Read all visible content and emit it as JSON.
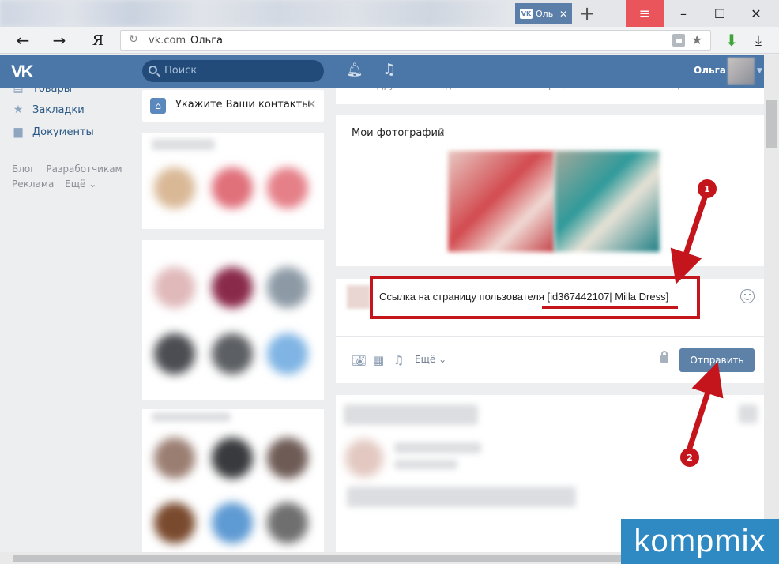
{
  "browser": {
    "tab_title": "Оль",
    "tab_favicon": "VK",
    "new_tab": "+",
    "menu_icon": "≡",
    "min_icon": "–",
    "max_icon": "☐",
    "close_icon": "✕",
    "back_icon": "←",
    "forward_icon": "→",
    "yandex_icon": "Я",
    "url_domain": "vk.com",
    "url_title": "Ольга"
  },
  "vk_header": {
    "logo": "VK",
    "search_placeholder": "Поиск",
    "user_name": "Ольга"
  },
  "left_nav": {
    "items": [
      {
        "label": "Товары"
      },
      {
        "label": "Закладки"
      },
      {
        "label": "Документы"
      }
    ],
    "footer_links": [
      "Блог",
      "Разработчикам",
      "Реклама",
      "Ещё ⌄"
    ]
  },
  "contacts_prompt": {
    "text": "Укажите Ваши контакты"
  },
  "profile_tabs": [
    "Друзья",
    "Подписчики",
    "Фотографии",
    "Отметки",
    "Видеозаписи"
  ],
  "photos": {
    "title": "Мои фотографии",
    "count": "2"
  },
  "composer": {
    "text": "Ссылка на страницу пользователя [id367442107| Milla Dress]",
    "more_label": "Ещё",
    "send_label": "Отправить"
  },
  "annotations": {
    "step1": "1",
    "step2": "2",
    "color": "#c4141c"
  },
  "watermark": {
    "text": "kompmix"
  },
  "colors": {
    "vk_blue": "#4a76a8",
    "send_button": "#5e81a8",
    "browser_menu_red": "#e9555a"
  }
}
